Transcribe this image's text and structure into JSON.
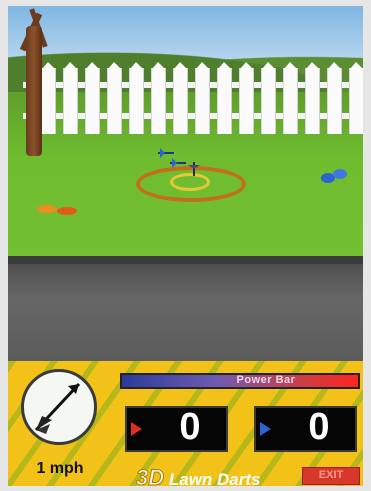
{
  "hud": {
    "wind_speed": "1 mph",
    "power_label": "Power Bar",
    "power_level": 1.0,
    "scores": {
      "red": "0",
      "blue": "0"
    },
    "title_prefix": "3D",
    "title_text": "Lawn Darts",
    "exit_button": "EXIT"
  },
  "icons": {
    "compass": "compass-dart-icon",
    "red_marker": "red-arrow-icon",
    "blue_marker": "blue-arrow-icon"
  },
  "colors": {
    "hud_yellow": "#f2c218",
    "red_player": "#e0311f",
    "blue_player": "#2b63d4",
    "target_ring": "#c26e1e"
  }
}
